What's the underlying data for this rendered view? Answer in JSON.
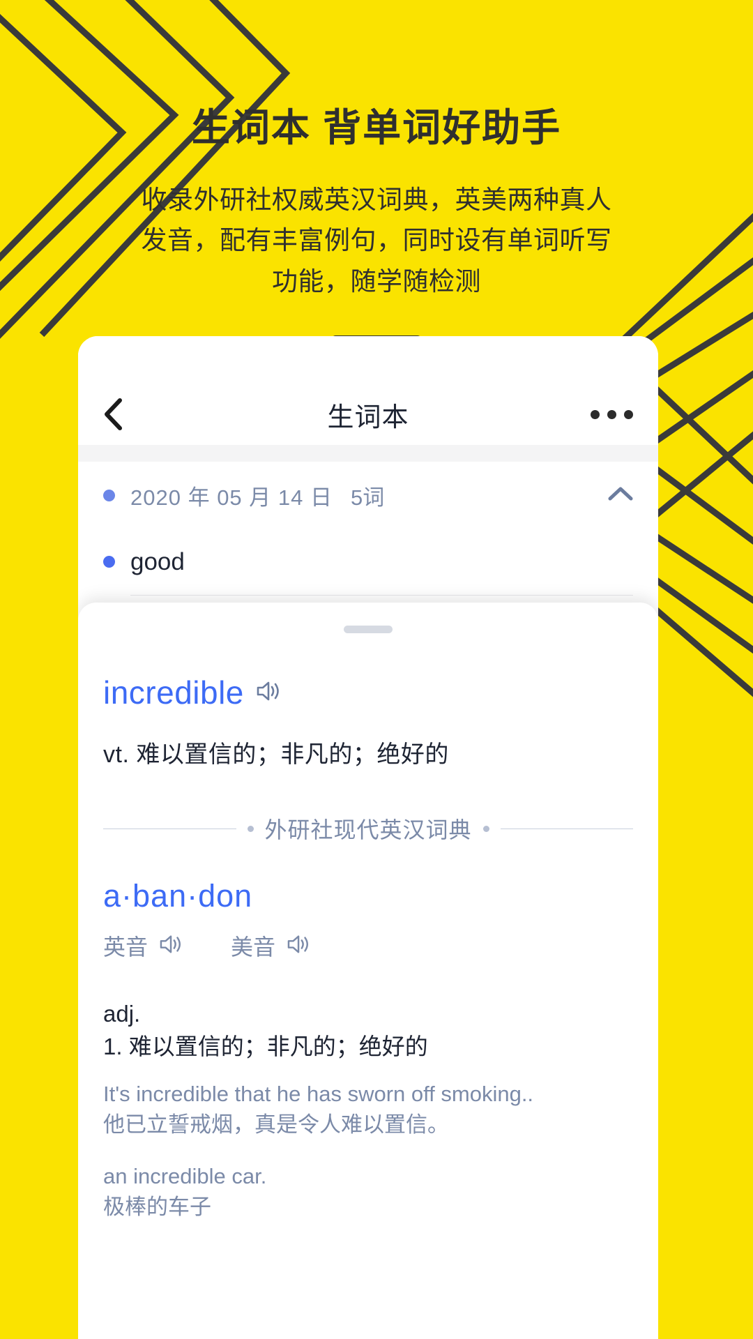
{
  "theme": {
    "background": "#FAE300",
    "ink": "#2f2f2f",
    "accent_blue": "#3d6bf5",
    "muted_blue": "#7b8aa8"
  },
  "promo": {
    "title": "生词本  背单词好助手",
    "subtitle": "收录外研社权威英汉词典，英美两种真人发音，配有丰富例句，同时设有单词听写功能，随学随检测"
  },
  "phone": {
    "navbar": {
      "back_icon": "chevron-left-icon",
      "title": "生词本",
      "more_icon": "more-horizontal-icon"
    },
    "list": {
      "group": {
        "date": "2020 年 05 月 14 日",
        "count": "5词",
        "collapse_icon": "chevron-up-icon"
      },
      "words": [
        {
          "text": "good",
          "highlighted": false
        },
        {
          "text": "incredible",
          "highlighted": true
        }
      ]
    },
    "sheet": {
      "handle": "drag-handle",
      "word": "incredible",
      "word_speaker_icon": "speaker-icon",
      "definition": "vt. 难以置信的；非凡的；绝好的",
      "source": "外研社现代英汉词典",
      "entry": {
        "headword": "a·ban·don",
        "pronunciations": [
          {
            "label": "英音",
            "icon": "speaker-icon"
          },
          {
            "label": "美音",
            "icon": "speaker-icon"
          }
        ],
        "part_of_speech": "adj.",
        "senses": [
          {
            "number": "1. 难以置信的；非凡的；绝好的",
            "examples": [
              {
                "en": "It's incredible that he has sworn off smoking..",
                "zh": "他已立誓戒烟，真是令人难以置信。"
              },
              {
                "en": "an incredible car.",
                "zh": "极棒的车子"
              }
            ]
          }
        ]
      }
    }
  }
}
